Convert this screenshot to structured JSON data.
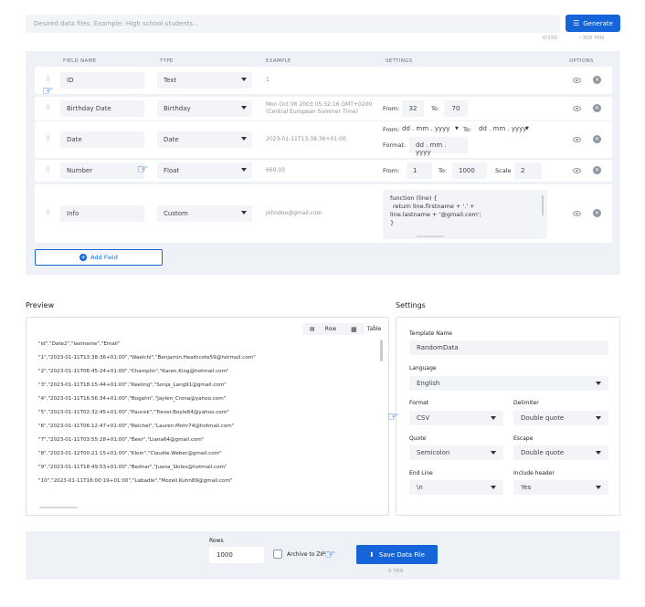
{
  "header": {
    "prompt_placeholder": "Desired data files. Example: High school students...",
    "generate_label": "Generate",
    "char_count": "0/150",
    "token_cost": "~300 TKN"
  },
  "fields_table": {
    "columns": [
      "FIELD NAME",
      "TYPE",
      "EXAMPLE",
      "SETTINGS",
      "OPTIONS"
    ],
    "rows": [
      {
        "name": "ID",
        "type": "Text",
        "example": "1"
      },
      {
        "name": "Birthday Date",
        "type": "Birthday",
        "example": "Mon Oct 06 2003 05:32:16 GMT+0200 (Central European Summer Time)",
        "from_label": "From:",
        "from_value": "32",
        "to_label": "To:",
        "to_value": "70"
      },
      {
        "name": "Date",
        "type": "Date",
        "example": "2023-01-11T13:38:36+01:00",
        "from_label": "From:",
        "from_value": "dd . mm . yyyy",
        "to_label": "To:",
        "to_value": "dd . mm . yyyy",
        "format_label": "Format:",
        "format_value": "dd . mm . yyyy"
      },
      {
        "name": "Number",
        "type": "Float",
        "example": "669.03",
        "from_label": "From:",
        "from_value": "1",
        "to_label": "To:",
        "to_value": "1000",
        "scale_label": "Scale",
        "scale_value": "2"
      },
      {
        "name": "Info",
        "type": "Custom",
        "example": "johndoe@gmail.com",
        "code_lines": [
          "function (line) {",
          "return line.firstname + '.' +",
          "line.lastname + '@gmail.com';",
          "}"
        ]
      }
    ],
    "add_field_label": "Add Field"
  },
  "preview": {
    "title": "Preview",
    "view_row_label": "Row",
    "view_table_label": "Table",
    "lines": [
      "\"id\",\"Date2\",\"lastname\",\"Email\"",
      "\"1\",\"2023-01-11T13:38:36+01:00\",\"Waelchi\",\"Benjamin.Heathcote59@hotmail.com\"",
      "\"2\",\"2023-01-11T06:45:24+01:00\",\"Champlin\",\"Karen.King@hotmail.com\"",
      "\"3\",\"2023-01-11T18:15:44+01:00\",\"Keeling\",\"Sonja_Lang91@gmail.com\"",
      "\"4\",\"2023-01-11T16:56:34+01:00\",\"Bogahn\",\"Jaylen_Crona@yahoo.com\"",
      "\"5\",\"2023-01-11T02:32:45+01:00\",\"Paucek\",\"Trever.Boyle64@yahoo.com\"",
      "\"6\",\"2023-01-11T06:12:47+01:00\",\"Reichel\",\"Lauren.Mohr74@hotmail.com\"",
      "\"7\",\"2023-01-11T03:55:28+01:00\",\"Beer\",\"Liana64@gmail.com\"",
      "\"8\",\"2023-01-12T00:21:15+01:00\",\"Klein\",\"Claudie.Weber@gmail.com\"",
      "\"9\",\"2023-01-11T18:49:53+01:00\",\"Bednar\",\"Juana_Skiles@hotmail.com\"",
      "\"10\",\"2023-01-11T16:00:19+01:00\",\"Labadie\",\"Mozell.Kuhn89@gmail.com\""
    ]
  },
  "settings": {
    "title": "Settings",
    "template_name_label": "Template Name",
    "template_name_value": "RandomData",
    "language_label": "Language",
    "language_value": "English",
    "format_label": "Format",
    "format_value": "CSV",
    "delimiter_label": "Delimiter",
    "delimiter_value": "Double quote",
    "quote_label": "Quote",
    "quote_value": "Semicolon",
    "escape_label": "Escape",
    "escape_value": "Double quote",
    "end_line_label": "End Line",
    "end_line_value": "\\n",
    "include_header_label": "Include header",
    "include_header_value": "Yes"
  },
  "footer": {
    "rows_label": "Rows",
    "rows_value": "1000",
    "archive_label": "Archive to ZIP",
    "save_label": "Save Data File",
    "save_cost": "0 TKN"
  },
  "colors": {
    "accent": "#1565d8",
    "panel": "#eef1f5"
  }
}
